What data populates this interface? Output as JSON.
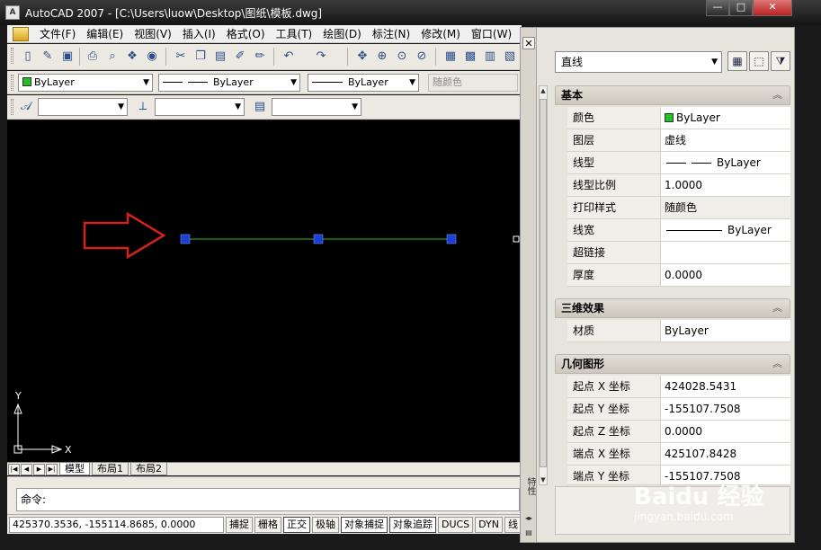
{
  "window": {
    "title": "AutoCAD 2007 - [C:\\Users\\luow\\Desktop\\图纸\\模板.dwg]",
    "buttons": [
      "—",
      "□",
      "✕"
    ]
  },
  "menu": [
    "文件(F)",
    "编辑(E)",
    "视图(V)",
    "插入(I)",
    "格式(O)",
    "工具(T)",
    "绘图(D)",
    "标注(N)",
    "修改(M)",
    "窗口(W)"
  ],
  "layers_toolbar": {
    "color": "ByLayer",
    "linetype": "ByLayer",
    "lineweight": "ByLayer",
    "plotstyle": "随颜色"
  },
  "tabs": {
    "model": "模型",
    "layout1": "布局1",
    "layout2": "布局2"
  },
  "ucs": {
    "x": "X",
    "y": "Y"
  },
  "command": {
    "prompt": "命令:"
  },
  "status": {
    "coords": "425370.3536, -155114.8685, 0.0000",
    "buttons": [
      "捕捉",
      "栅格",
      "正交",
      "极轴",
      "对象捕捉",
      "对象追踪",
      "DUCS",
      "DYN",
      "线"
    ]
  },
  "palette": {
    "vertical_label": "特性",
    "object_type": "直线",
    "sections": {
      "basic": {
        "title": "基本",
        "props": [
          {
            "name": "颜色",
            "value": "ByLayer"
          },
          {
            "name": "图层",
            "value": "虚线"
          },
          {
            "name": "线型",
            "value": "ByLayer"
          },
          {
            "name": "线型比例",
            "value": "1.0000"
          },
          {
            "name": "打印样式",
            "value": "随颜色"
          },
          {
            "name": "线宽",
            "value": "ByLayer"
          },
          {
            "name": "超链接",
            "value": ""
          },
          {
            "name": "厚度",
            "value": "0.0000"
          }
        ]
      },
      "three_d": {
        "title": "三维效果",
        "props": [
          {
            "name": "材质",
            "value": "ByLayer"
          }
        ]
      },
      "geometry": {
        "title": "几何图形",
        "props": [
          {
            "name": "起点 X 坐标",
            "value": "424028.5431"
          },
          {
            "name": "起点 Y 坐标",
            "value": "-155107.7508"
          },
          {
            "name": "起点 Z 坐标",
            "value": "0.0000"
          },
          {
            "name": "端点 X 坐标",
            "value": "425107.8428"
          },
          {
            "name": "端点 Y 坐标",
            "value": "-155107.7508"
          }
        ]
      }
    }
  },
  "colors": {
    "selected_line": "#22c022",
    "grip": "#1a3fd6",
    "arrow": "#d42020",
    "canvas": "#000000"
  },
  "watermark": {
    "brand": "Baidu 经验",
    "url": "jingyan.baidu.com"
  }
}
